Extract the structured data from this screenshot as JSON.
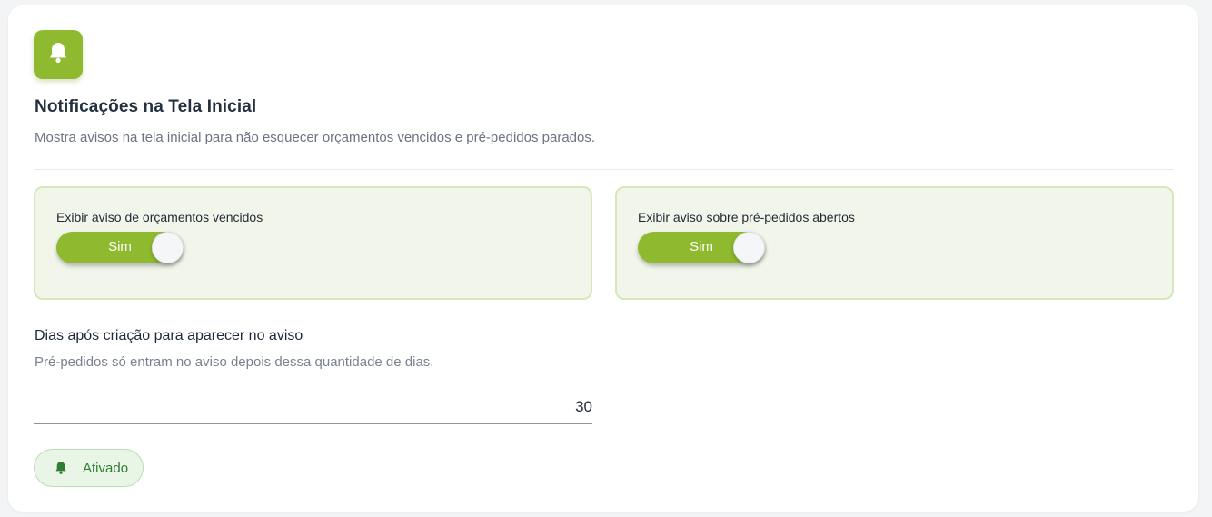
{
  "header": {
    "icon": "bell-icon",
    "title": "Notificações na Tela Inicial",
    "subtitle": "Mostra avisos na tela inicial para não esquecer orçamentos vencidos e pré-pedidos parados."
  },
  "options": [
    {
      "label": "Exibir aviso de orçamentos vencidos",
      "toggle_text": "Sim",
      "enabled": true
    },
    {
      "label": "Exibir aviso sobre pré-pedidos abertos",
      "toggle_text": "Sim",
      "enabled": true
    }
  ],
  "days_field": {
    "label": "Dias após criação para aparecer no aviso",
    "help": "Pré-pedidos só entram no aviso depois dessa quantidade de dias.",
    "value": "30"
  },
  "status": {
    "icon": "bell-icon",
    "text": "Ativado"
  },
  "colors": {
    "accent": "#8fba2f",
    "option_bg": "#f2f6ea",
    "status_text": "#2e7d32"
  }
}
